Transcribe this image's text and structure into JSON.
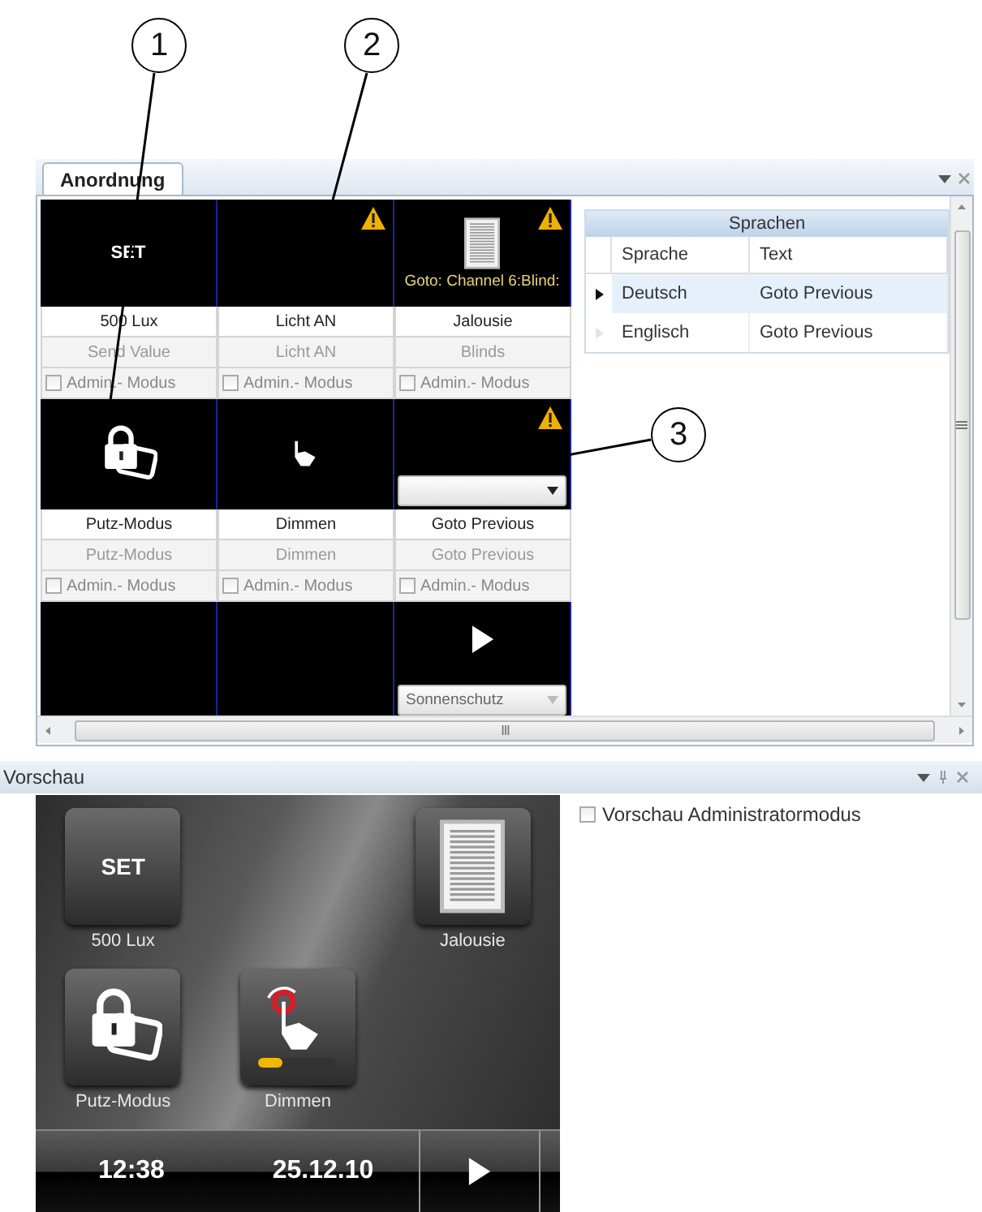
{
  "annotations": [
    {
      "number": "1"
    },
    {
      "number": "2"
    },
    {
      "number": "3"
    }
  ],
  "layout_panel": {
    "tab": "Anordnung",
    "tile_rows": [
      [
        {
          "kind": "set",
          "icon_text": "SET",
          "warning": false,
          "name": "500 Lux",
          "subtitle": "Send Value",
          "admin": {
            "label": "Admin.- Modus",
            "checked": false
          }
        },
        {
          "kind": "none",
          "warning": true,
          "name": "Licht AN",
          "subtitle": "Licht AN",
          "admin": {
            "label": "Admin.- Modus",
            "checked": false
          }
        },
        {
          "kind": "blinds",
          "warning": true,
          "caption": "Goto: Channel 6:Blind:",
          "name": "Jalousie",
          "subtitle": "Blinds",
          "admin": {
            "label": "Admin.- Modus",
            "checked": false
          }
        }
      ],
      [
        {
          "kind": "lock",
          "warning": false,
          "name": "Putz-Modus",
          "subtitle": "Putz-Modus",
          "admin": {
            "label": "Admin.- Modus",
            "checked": false
          }
        },
        {
          "kind": "hand",
          "warning": false,
          "name": "Dimmen",
          "subtitle": "Dimmen",
          "admin": {
            "label": "Admin.- Modus",
            "checked": false
          }
        },
        {
          "kind": "none",
          "warning": true,
          "selector": {
            "disabled": false
          },
          "name": "Goto Previous",
          "subtitle": "Goto Previous",
          "admin": {
            "label": "Admin.- Modus",
            "checked": false
          }
        }
      ],
      [
        {
          "kind": "none",
          "warning": false
        },
        {
          "kind": "none",
          "warning": false
        },
        {
          "kind": "play",
          "warning": false,
          "selector": {
            "value": "Sonnenschutz",
            "disabled": true
          }
        }
      ]
    ]
  },
  "languages": {
    "title": "Sprachen",
    "columns": [
      "Sprache",
      "Text"
    ],
    "rows": [
      {
        "language": "Deutsch",
        "text": "Goto Previous",
        "selected": true
      },
      {
        "language": "Englisch",
        "text": "Goto Previous",
        "selected": false
      }
    ]
  },
  "preview_panel": {
    "title": "Vorschau",
    "device": {
      "tiles": [
        {
          "kind": "set",
          "icon_text": "SET",
          "label": "500 Lux"
        },
        {
          "kind": "none"
        },
        {
          "kind": "blinds",
          "label": "Jalousie"
        },
        {
          "kind": "lock",
          "label": "Putz-Modus"
        },
        {
          "kind": "dimmer",
          "label": "Dimmen",
          "level": 0.3
        },
        {
          "kind": "none"
        }
      ],
      "time": "12:38",
      "date": "25.12.10"
    },
    "admin_mode": {
      "label": "Vorschau Administratormodus",
      "checked": false
    }
  }
}
